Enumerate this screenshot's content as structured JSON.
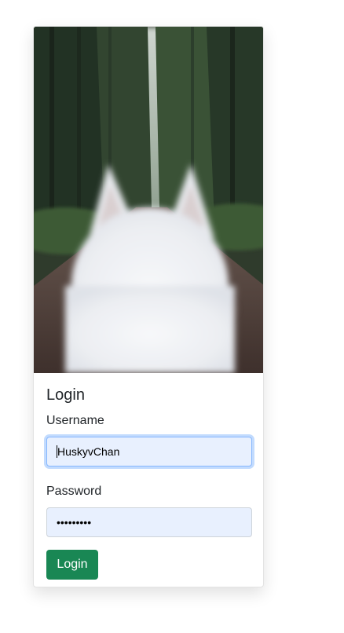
{
  "login": {
    "title": "Login",
    "username_label": "Username",
    "username_value": "HuskyvChan",
    "password_label": "Password",
    "password_masked": "•••••••••",
    "submit_label": "Login"
  },
  "colors": {
    "button": "#198754",
    "autofill_bg": "#e8f0fe",
    "focus_ring": "#86b7fe"
  }
}
